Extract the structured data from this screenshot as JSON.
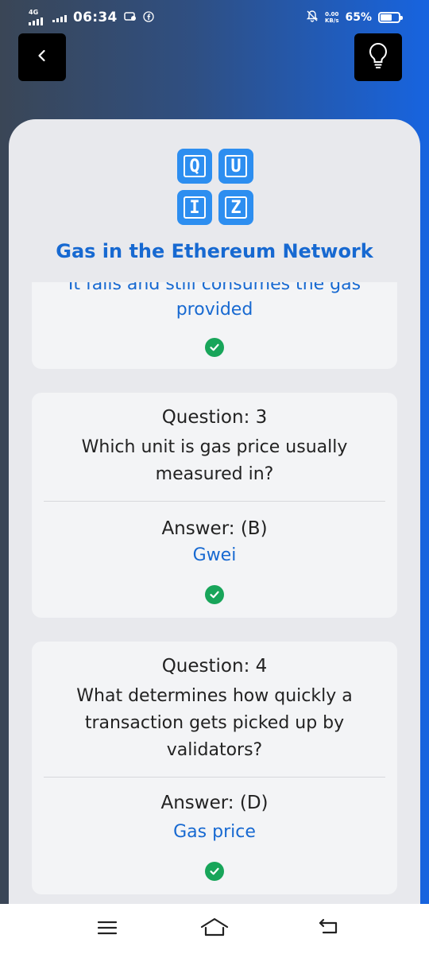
{
  "status_bar": {
    "network": "4G",
    "time": "06:34",
    "speed_value": "0.00",
    "speed_unit": "KB/s",
    "battery": "65%",
    "battery_level": 0.65
  },
  "quiz": {
    "title": "Gas in the Ethereum Network",
    "logo_letters": [
      "Q",
      "U",
      "I",
      "Z"
    ],
    "partial_card": {
      "answer_line1": "It fails and still consumes the gas",
      "answer_line2": "provided"
    },
    "questions": [
      {
        "question_label": "Question: 3",
        "question_text": "Which unit is gas price usually measured in?",
        "answer_label": "Answer: (B)",
        "answer_text": "Gwei"
      },
      {
        "question_label": "Question: 4",
        "question_text": "What determines how quickly a transaction gets picked up by validators?",
        "answer_label": "Answer: (D)",
        "answer_text": "Gas price"
      }
    ]
  },
  "icons": {
    "back": "chevron-left-icon",
    "hint": "lightbulb-icon",
    "correct": "check-circle-icon",
    "nav_menu": "menu-icon",
    "nav_home": "home-icon",
    "nav_back": "back-icon"
  },
  "colors": {
    "accent": "#1769d1",
    "correct": "#18a55a",
    "logo_tile": "#2d8ef0"
  }
}
